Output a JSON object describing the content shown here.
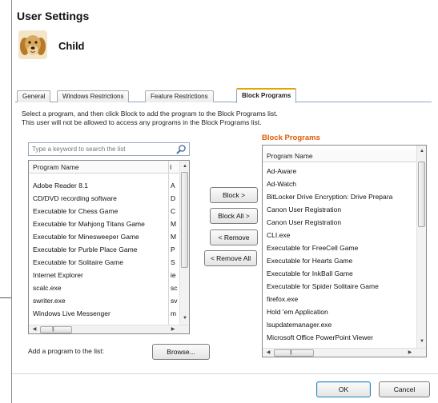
{
  "window": {
    "title": "User Settings"
  },
  "user": {
    "name": "Child"
  },
  "tabs": [
    {
      "label": "General"
    },
    {
      "label": "Windows Restrictions"
    },
    {
      "label": "Feature Restrictions"
    },
    {
      "label": "Block Programs"
    }
  ],
  "instructions": {
    "line1": "Select a program, and then click Block to add the program to the Block Programs list.",
    "line2": "This user will not be allowed to access any programs in the Block Programs list."
  },
  "search": {
    "placeholder": "Type a keyword to search the list",
    "icon": "search-icon"
  },
  "available_list": {
    "columns": [
      "Program Name",
      "I"
    ],
    "rows": [
      {
        "name": "Adobe Reader 8.1",
        "col2": "A"
      },
      {
        "name": "CD/DVD recording software",
        "col2": "D"
      },
      {
        "name": "Executable for Chess Game",
        "col2": "C"
      },
      {
        "name": "Executable for Mahjong Titans Game",
        "col2": "M"
      },
      {
        "name": "Executable for Minesweeper Game",
        "col2": "M"
      },
      {
        "name": "Executable for Purble Place Game",
        "col2": "P"
      },
      {
        "name": "Executable for Solitaire Game",
        "col2": "S"
      },
      {
        "name": "Internet Explorer",
        "col2": "ie"
      },
      {
        "name": "scalc.exe",
        "col2": "sc"
      },
      {
        "name": "swriter.exe",
        "col2": "sv"
      },
      {
        "name": "Windows Live Messenger",
        "col2": "m"
      }
    ]
  },
  "actions": {
    "block": "Block >",
    "block_all": "Block All >",
    "remove": "< Remove",
    "remove_all": "< Remove All"
  },
  "blocked_section": {
    "title": "Block Programs",
    "column": "Program Name"
  },
  "blocked_list": [
    "Ad-Aware",
    "Ad-Watch",
    "BitLocker Drive Encryption: Drive Prepara",
    "Canon User Registration",
    "Canon User Registration",
    "CLI.exe",
    "Executable for FreeCell Game",
    "Executable for Hearts Game",
    "Executable for InkBall Game",
    "Executable for Spider Solitaire Game",
    "firefox.exe",
    "Hold 'em Application",
    "lsupdatemanager.exe",
    "Microsoft Office PowerPoint Viewer"
  ],
  "scroll_grip": "|||",
  "add_program": {
    "label": "Add a program to the list:",
    "browse": "Browse..."
  },
  "footer": {
    "ok": "OK",
    "cancel": "Cancel"
  },
  "colors": {
    "accent_orange": "#e05a00",
    "tab_highlight": "#e8a200",
    "default_button": "#3c7fb1"
  }
}
